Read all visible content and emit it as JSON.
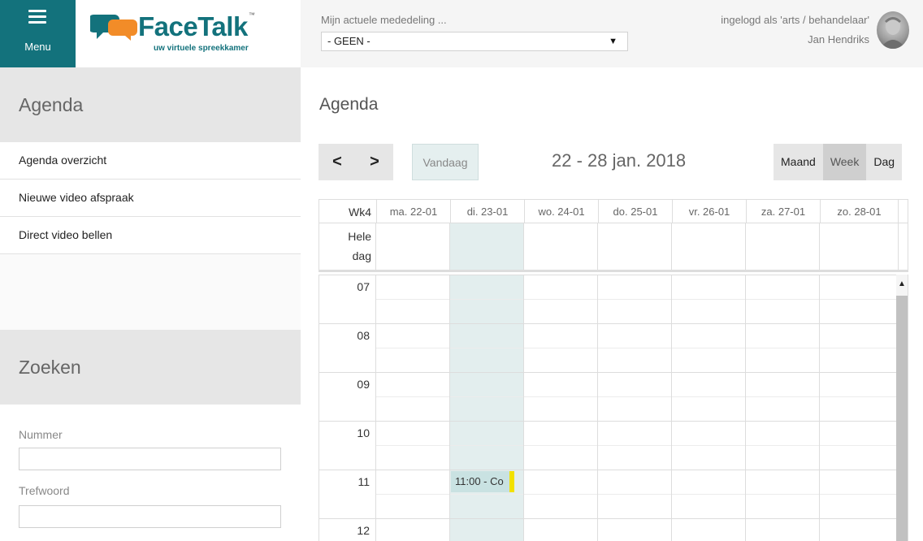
{
  "app": {
    "menu_label": "Menu",
    "logo_name": "FaceTalk",
    "logo_tm": "™",
    "logo_tagline": "uw virtuele spreekkamer"
  },
  "topbar": {
    "notice_label": "Mijn actuele mededeling ...",
    "notice_value": "- GEEN -",
    "user_role": "ingelogd als 'arts / behandelaar'",
    "user_name": "Jan Hendriks"
  },
  "sidebar": {
    "agenda_title": "Agenda",
    "links": [
      {
        "label": "Agenda overzicht"
      },
      {
        "label": "Nieuwe video afspraak"
      },
      {
        "label": "Direct video bellen"
      }
    ],
    "search_title": "Zoeken",
    "nummer_label": "Nummer",
    "trefwoord_label": "Trefwoord"
  },
  "main": {
    "title": "Agenda",
    "prev_label": "<",
    "next_label": ">",
    "today_label": "Vandaag",
    "range": "22 - 28 jan. 2018",
    "views": [
      "Maand",
      "Week",
      "Dag"
    ],
    "active_view": "Week"
  },
  "calendar": {
    "week_label": "Wk4",
    "days": [
      "ma. 22-01",
      "di. 23-01",
      "wo. 24-01",
      "do. 25-01",
      "vr. 26-01",
      "za. 27-01",
      "zo. 28-01"
    ],
    "today_index": 1,
    "allday_label_1": "Hele",
    "allday_label_2": "dag",
    "hours": [
      "07",
      "08",
      "09",
      "10",
      "11",
      "12"
    ],
    "event": {
      "label": "11:00 - Co",
      "day": "di. 23-01",
      "start": "11:00",
      "accent": "#f2e100"
    }
  },
  "colors": {
    "brand": "#13727c",
    "today_column": "#e3eeee",
    "event_bg": "#c9e2e2"
  }
}
